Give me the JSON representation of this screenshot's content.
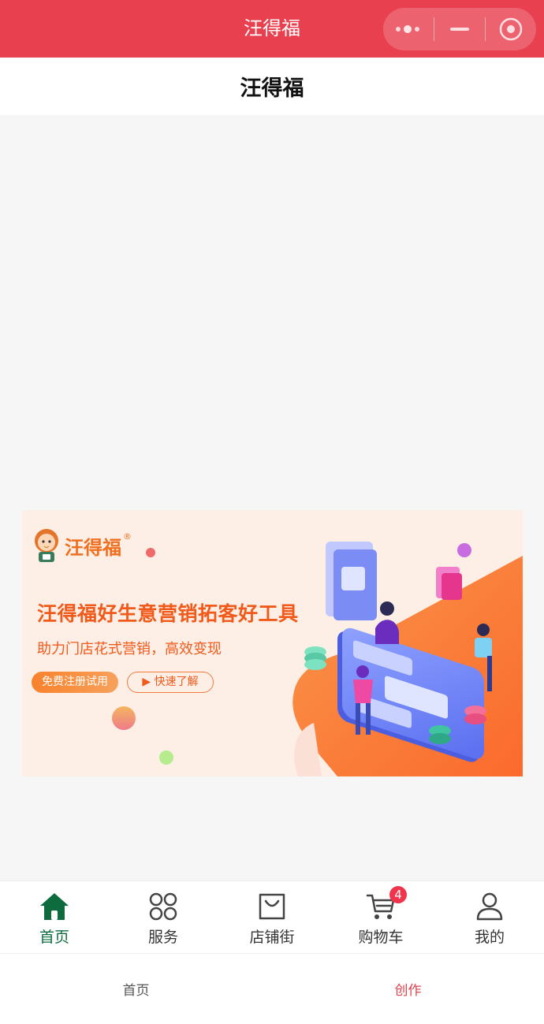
{
  "titlebar": {
    "title": "汪得福"
  },
  "header": {
    "title": "汪得福"
  },
  "banner": {
    "brand_name": "汪得福",
    "registered_mark": "®",
    "headline": "汪得福好生意营销拓客好工具",
    "subline": "助力门店花式营销，高效变现",
    "trial_button": "免费注册试用",
    "learn_button": "▶ 快速了解"
  },
  "tabbar": {
    "items": [
      {
        "label": "首页",
        "icon": "home-icon",
        "active": true
      },
      {
        "label": "服务",
        "icon": "grid-icon",
        "active": false
      },
      {
        "label": "店铺街",
        "icon": "shopping-bag-icon",
        "active": false
      },
      {
        "label": "购物车",
        "icon": "cart-icon",
        "active": false,
        "badge": "4"
      },
      {
        "label": "我的",
        "icon": "user-icon",
        "active": false
      }
    ]
  },
  "bottomnav": {
    "items": [
      {
        "label": "首页",
        "active": false
      },
      {
        "label": "创作",
        "active": true
      }
    ]
  },
  "colors": {
    "topbar": "#e8404f",
    "active_tab": "#0e6b3e",
    "badge": "#f0344b",
    "banner_accent": "#f05a1a"
  }
}
